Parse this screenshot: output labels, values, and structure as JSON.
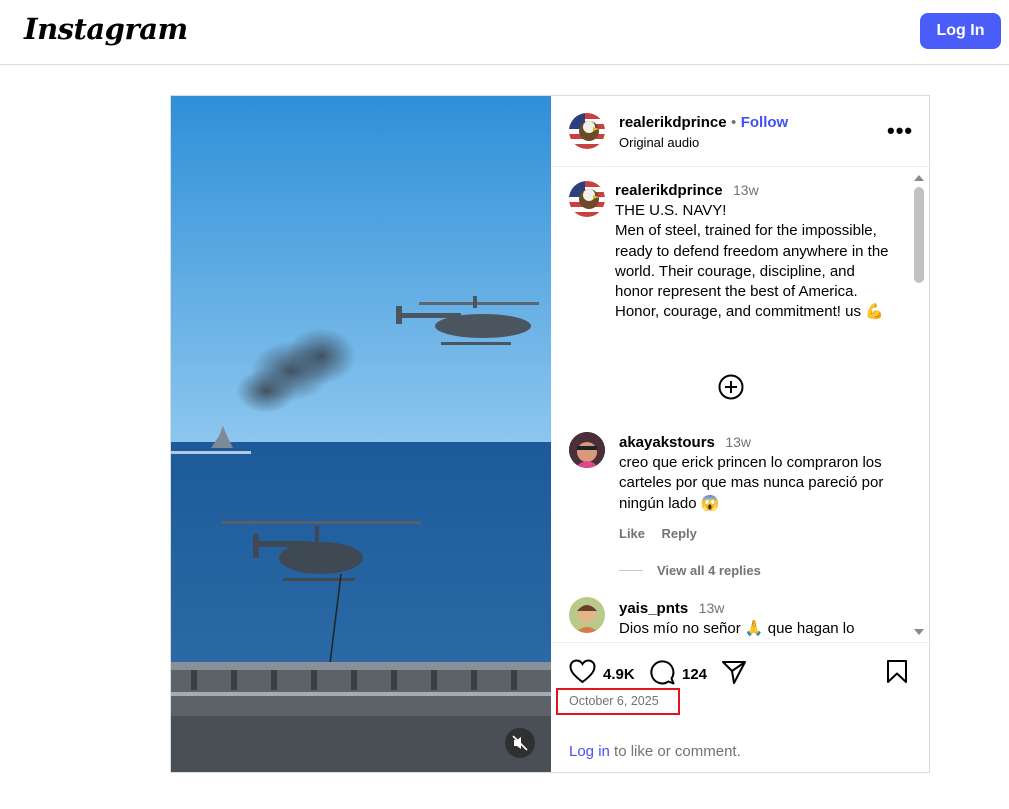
{
  "header": {
    "logo": "Instagram",
    "login_label": "Log In"
  },
  "post": {
    "author": "realerikdprince",
    "follow_label": "Follow",
    "separator": "•",
    "audio": "Original audio",
    "more_icon": "more-horizontal-icon",
    "caption": {
      "username": "realerikdprince",
      "time": "13w",
      "text": "THE U.S. NAVY!\nMen of steel, trained for the impossible, ready to defend freedom anywhere in the world. Their courage, discipline, and honor represent the best of America. Honor, courage, and commitment! us 💪"
    },
    "comments": [
      {
        "username": "akayakstours",
        "time": "13w",
        "text": "creo que erick princen lo compraron los carteles por que mas nunca pareció por ningún lado 😱",
        "like_label": "Like",
        "reply_label": "Reply",
        "view_replies": "View all 4 replies"
      },
      {
        "username": "yais_pnts",
        "time": "13w",
        "text": "Dios mío no señor 🙏 que hagan lo"
      }
    ],
    "likes": "4.9K",
    "comments_count": "124",
    "date": "October 6, 2025",
    "footer": {
      "login_link": "Log in",
      "rest": " to like or comment."
    }
  },
  "colors": {
    "accent": "#4a5df9",
    "link": "#4150f7",
    "highlight_box": "#e0141c",
    "secondary_text": "#737373"
  }
}
